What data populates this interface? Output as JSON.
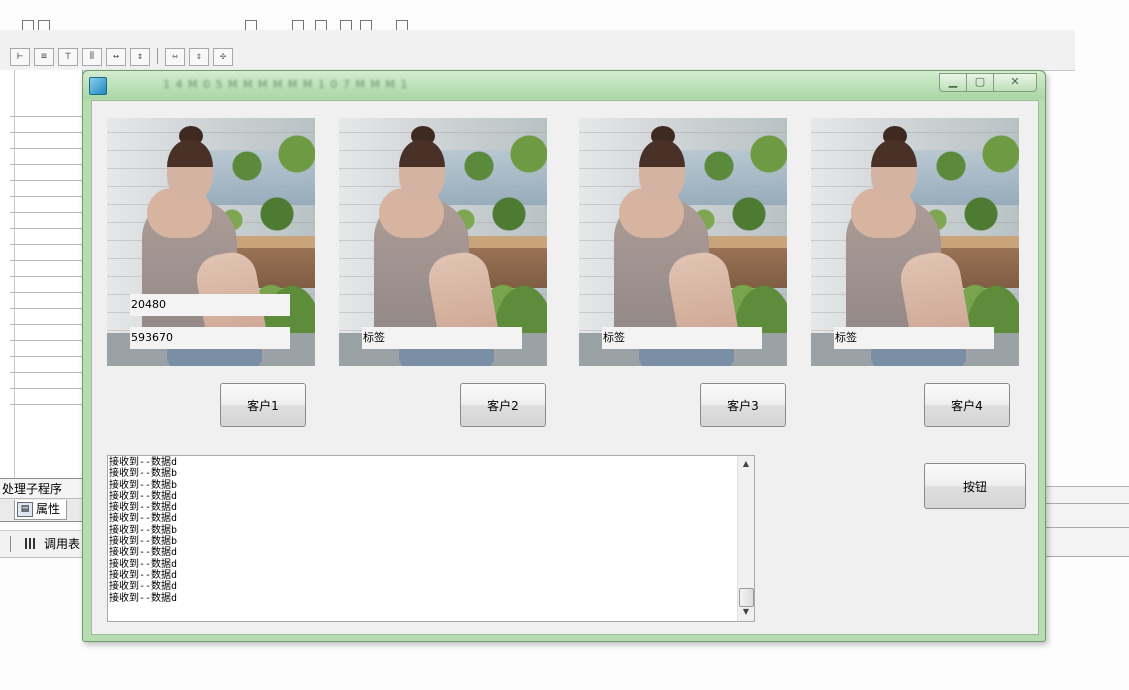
{
  "window": {
    "title_blurred": "1 4 M 0 5   M M M M M M   1 0 7   M M   M   1"
  },
  "ide": {
    "panel_title": "处理子程序",
    "tab_properties": "属性",
    "tab_call_table": "调用表"
  },
  "images": [
    {
      "label_top": "20480",
      "label_bottom": "593670",
      "button": "客户1"
    },
    {
      "label_bottom": "标签",
      "button": "客户2"
    },
    {
      "label_bottom": "标签",
      "button": "客户3"
    },
    {
      "label_bottom": "标签",
      "button": "客户4"
    }
  ],
  "main_button": "按钮",
  "log": {
    "lines": [
      "接收到--数据d",
      "接收到--数据b",
      "接收到--数据b",
      "接收到--数据d",
      "接收到--数据d",
      "接收到--数据d",
      "接收到--数据b",
      "接收到--数据b",
      "接收到--数据d",
      "接收到--数据d",
      "接收到--数据d",
      "接收到--数据d",
      "接收到--数据d"
    ]
  }
}
